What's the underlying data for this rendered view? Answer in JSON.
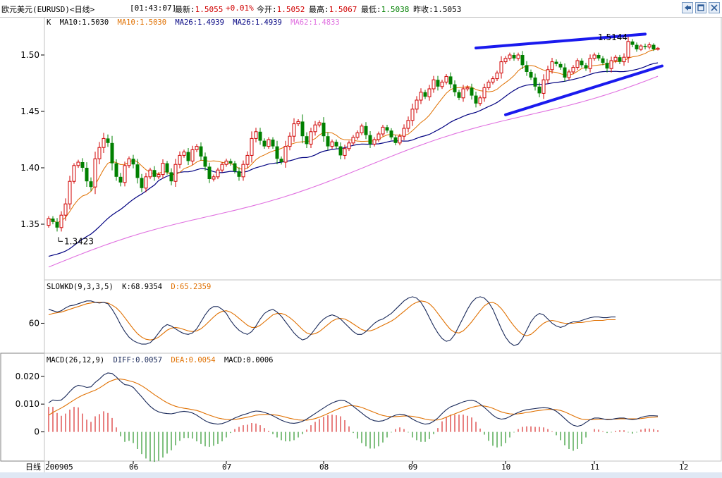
{
  "window": {
    "title": "欧元美元(EURUSD)<日线>",
    "time": "[01:43:07]",
    "quote": [
      {
        "label": "最新:",
        "value": "1.5055",
        "color": "#d00000"
      },
      {
        "label": "",
        "value": "+0.01%",
        "color": "#d00000"
      },
      {
        "label": "今开:",
        "value": "1.5052",
        "color": "#d00000"
      },
      {
        "label": "最高:",
        "value": "1.5067",
        "color": "#d00000"
      },
      {
        "label": "最低:",
        "value": "1.5038",
        "color": "#008000"
      },
      {
        "label": "昨收:",
        "value": "1.5053",
        "color": "#000000"
      }
    ],
    "buttons": [
      "back-icon",
      "restore-icon",
      "close-icon"
    ]
  },
  "chart_data": {
    "type": "candlestick",
    "x_period_label": "日线",
    "x_ticks": [
      {
        "label": "200905",
        "i": 0
      },
      {
        "label": "06",
        "i": 20
      },
      {
        "label": "07",
        "i": 42
      },
      {
        "label": "08",
        "i": 65
      },
      {
        "label": "09",
        "i": 86
      },
      {
        "label": "10",
        "i": 108
      },
      {
        "label": "11",
        "i": 129
      },
      {
        "label": "12",
        "i": 150
      }
    ],
    "price_panel": {
      "legend": [
        {
          "text": "K",
          "color": "#000000"
        },
        {
          "text": "MA10:1.5030",
          "color": "#000000"
        },
        {
          "text": "MA10:1.5030",
          "color": "#e07000"
        },
        {
          "text": "MA26:1.4939",
          "color": "#000080"
        },
        {
          "text": "MA26:1.4939",
          "color": "#000080"
        },
        {
          "text": "MA62:1.4833",
          "color": "#e070e0"
        }
      ],
      "ylim": [
        1.305,
        1.525
      ],
      "yticks": [
        "1.35",
        "1.40",
        "1.45",
        "1.50"
      ],
      "annotations": [
        {
          "text": "1.3423",
          "i": 2,
          "price": 1.3423
        },
        {
          "text": "1.5144",
          "i": 139,
          "price": 1.5144
        }
      ],
      "trendlines": [
        {
          "from": [
            101,
            1.5062
          ],
          "to": [
            141,
            1.5185
          ]
        },
        {
          "from": [
            108,
            1.447
          ],
          "to": [
            145,
            1.4903
          ]
        }
      ],
      "ma_colors": {
        "ma10": "#e07000",
        "ma26": "#000080",
        "ma62": "#e070e0"
      },
      "ma62_start": 1.312,
      "ma62_end": 1.4833,
      "ma26_start": 1.3255,
      "ma26_end": 1.4939,
      "up_color": "#d00000",
      "down_color": "#008000",
      "closes": [
        1.355,
        1.352,
        1.347,
        1.358,
        1.368,
        1.388,
        1.402,
        1.405,
        1.4,
        1.388,
        1.383,
        1.408,
        1.418,
        1.426,
        1.422,
        1.404,
        1.392,
        1.387,
        1.402,
        1.408,
        1.403,
        1.391,
        1.382,
        1.392,
        1.398,
        1.392,
        1.394,
        1.404,
        1.396,
        1.388,
        1.403,
        1.411,
        1.414,
        1.406,
        1.416,
        1.419,
        1.41,
        1.401,
        1.39,
        1.392,
        1.398,
        1.403,
        1.406,
        1.404,
        1.397,
        1.392,
        1.403,
        1.411,
        1.426,
        1.432,
        1.424,
        1.419,
        1.425,
        1.419,
        1.408,
        1.405,
        1.419,
        1.428,
        1.439,
        1.441,
        1.428,
        1.421,
        1.432,
        1.438,
        1.44,
        1.428,
        1.419,
        1.423,
        1.419,
        1.411,
        1.417,
        1.422,
        1.427,
        1.431,
        1.437,
        1.429,
        1.421,
        1.425,
        1.43,
        1.436,
        1.433,
        1.427,
        1.422,
        1.428,
        1.435,
        1.442,
        1.452,
        1.46,
        1.467,
        1.463,
        1.47,
        1.478,
        1.472,
        1.476,
        1.481,
        1.474,
        1.467,
        1.462,
        1.47,
        1.471,
        1.464,
        1.457,
        1.462,
        1.471,
        1.476,
        1.479,
        1.484,
        1.494,
        1.497,
        1.5,
        1.497,
        1.5,
        1.491,
        1.485,
        1.48,
        1.472,
        1.466,
        1.478,
        1.487,
        1.494,
        1.492,
        1.489,
        1.48,
        1.485,
        1.489,
        1.495,
        1.491,
        1.488,
        1.497,
        1.5,
        1.497,
        1.493,
        1.488,
        1.495,
        1.498,
        1.494,
        1.498,
        1.512,
        1.509,
        1.505,
        1.508,
        1.507,
        1.509,
        1.505,
        1.506
      ],
      "ranges": [
        0.006,
        0.006,
        0.01,
        0.01,
        0.014,
        0.014,
        0.006,
        0.006,
        0.01,
        0.014,
        0.01,
        0.018,
        0.014,
        0.014,
        0.01,
        0.018,
        0.01,
        0.01,
        0.01,
        0.006,
        0.01,
        0.014,
        0.01,
        0.01,
        0.006,
        0.01,
        0.006,
        0.01,
        0.006,
        0.01,
        0.014,
        0.01,
        0.006,
        0.01,
        0.01,
        0.006,
        0.01,
        0.01,
        0.01,
        0.006,
        0.006,
        0.006,
        0.006,
        0.006,
        0.006,
        0.01,
        0.01,
        0.01,
        0.018,
        0.01,
        0.01,
        0.006,
        0.006,
        0.006,
        0.014,
        0.006,
        0.014,
        0.01,
        0.014,
        0.006,
        0.018,
        0.01,
        0.01,
        0.01,
        0.006,
        0.014,
        0.01,
        0.006,
        0.006,
        0.01,
        0.01,
        0.006,
        0.006,
        0.006,
        0.006,
        0.01,
        0.01,
        0.006,
        0.006,
        0.006,
        0.006,
        0.006,
        0.006,
        0.006,
        0.01,
        0.01,
        0.014,
        0.01,
        0.01,
        0.006,
        0.01,
        0.01,
        0.01,
        0.006,
        0.006,
        0.01,
        0.01,
        0.006,
        0.01,
        0.006,
        0.01,
        0.01,
        0.006,
        0.01,
        0.006,
        0.006,
        0.006,
        0.014,
        0.006,
        0.006,
        0.006,
        0.006,
        0.01,
        0.01,
        0.006,
        0.01,
        0.01,
        0.014,
        0.01,
        0.01,
        0.006,
        0.006,
        0.01,
        0.006,
        0.006,
        0.006,
        0.006,
        0.006,
        0.01,
        0.006,
        0.006,
        0.006,
        0.01,
        0.01,
        0.006,
        0.006,
        0.01,
        0.014,
        0.006,
        0.006,
        0.004,
        0.006,
        0.006,
        0.004,
        0.003
      ]
    },
    "kd_panel": {
      "label": "SLOWKD(9,3,3,5)",
      "k_text": "K:68.9354",
      "d_text": "D:65.2359",
      "k_color": "#1a2a5a",
      "d_color": "#e07000",
      "ylim": [
        20,
        105
      ],
      "ytick": "60",
      "k": [
        80,
        78,
        76,
        78,
        82,
        85,
        86,
        88,
        90,
        92,
        92,
        90,
        89,
        90,
        88,
        80,
        70,
        58,
        48,
        40,
        35,
        32,
        30,
        30,
        32,
        38,
        46,
        54,
        58,
        56,
        52,
        48,
        45,
        44,
        46,
        52,
        62,
        72,
        80,
        84,
        84,
        80,
        74,
        64,
        56,
        50,
        46,
        44,
        48,
        56,
        66,
        74,
        78,
        80,
        76,
        70,
        62,
        54,
        46,
        40,
        36,
        38,
        44,
        52,
        60,
        66,
        70,
        72,
        70,
        66,
        60,
        54,
        48,
        44,
        44,
        48,
        54,
        60,
        64,
        66,
        70,
        74,
        80,
        86,
        92,
        96,
        98,
        96,
        90,
        80,
        68,
        56,
        46,
        38,
        34,
        36,
        44,
        56,
        68,
        80,
        90,
        96,
        98,
        96,
        90,
        80,
        66,
        52,
        40,
        32,
        28,
        30,
        38,
        50,
        62,
        70,
        74,
        72,
        66,
        60,
        56,
        54,
        56,
        60,
        62,
        62,
        64,
        66,
        68,
        69,
        69,
        68,
        68,
        69,
        69
      ],
      "d": [
        72,
        74,
        75,
        76,
        78,
        80,
        82,
        84,
        86,
        88,
        89,
        90,
        90,
        90,
        89,
        86,
        82,
        76,
        68,
        60,
        52,
        45,
        40,
        37,
        36,
        37,
        40,
        45,
        50,
        53,
        54,
        53,
        51,
        49,
        48,
        49,
        52,
        57,
        63,
        69,
        74,
        77,
        78,
        76,
        72,
        67,
        62,
        57,
        54,
        54,
        57,
        62,
        67,
        72,
        74,
        74,
        72,
        68,
        63,
        57,
        51,
        46,
        44,
        45,
        48,
        53,
        58,
        63,
        66,
        67,
        66,
        63,
        59,
        55,
        51,
        49,
        49,
        51,
        54,
        57,
        60,
        63,
        67,
        72,
        77,
        82,
        87,
        90,
        92,
        91,
        88,
        82,
        74,
        66,
        58,
        51,
        47,
        46,
        49,
        55,
        62,
        70,
        78,
        85,
        89,
        90,
        87,
        81,
        73,
        64,
        56,
        49,
        44,
        42,
        44,
        49,
        55,
        60,
        63,
        64,
        63,
        61,
        60,
        60,
        60,
        61,
        61,
        62,
        63,
        64,
        64,
        64,
        65,
        65,
        65
      ]
    },
    "macd_panel": {
      "label": "MACD(26,12,9)",
      "diff_text": "DIFF:0.0057",
      "dea_text": "DEA:0.0054",
      "macd_text": "MACD:0.0006",
      "diff_color": "#1a2a5a",
      "dea_color": "#e07000",
      "ylim": [
        -0.01,
        0.024
      ],
      "yticks": [
        "0.020",
        "0.010",
        "0"
      ],
      "diff": [
        0.0105,
        0.0115,
        0.0112,
        0.0115,
        0.0128,
        0.0145,
        0.016,
        0.0168,
        0.0165,
        0.016,
        0.0162,
        0.0178,
        0.019,
        0.0205,
        0.0212,
        0.021,
        0.0198,
        0.0182,
        0.017,
        0.0168,
        0.016,
        0.0143,
        0.0126,
        0.0108,
        0.0092,
        0.008,
        0.0072,
        0.0068,
        0.0066,
        0.0065,
        0.0068,
        0.0072,
        0.0074,
        0.0072,
        0.0068,
        0.006,
        0.005,
        0.004,
        0.0033,
        0.003,
        0.0028,
        0.003,
        0.0035,
        0.0042,
        0.005,
        0.0056,
        0.0062,
        0.0066,
        0.0072,
        0.0075,
        0.0074,
        0.007,
        0.0065,
        0.0058,
        0.005,
        0.0042,
        0.0036,
        0.0032,
        0.0031,
        0.0033,
        0.0038,
        0.0046,
        0.0056,
        0.0066,
        0.0076,
        0.0086,
        0.0096,
        0.0104,
        0.011,
        0.0114,
        0.0112,
        0.0104,
        0.0092,
        0.008,
        0.0068,
        0.0056,
        0.0046,
        0.004,
        0.0038,
        0.004,
        0.0046,
        0.0054,
        0.006,
        0.0064,
        0.0062,
        0.0056,
        0.0046,
        0.0038,
        0.0032,
        0.0028,
        0.003,
        0.0038,
        0.005,
        0.0066,
        0.008,
        0.009,
        0.0096,
        0.0102,
        0.0108,
        0.0112,
        0.0114,
        0.011,
        0.01,
        0.0088,
        0.0074,
        0.006,
        0.005,
        0.0046,
        0.0048,
        0.0055,
        0.0063,
        0.007,
        0.0076,
        0.008,
        0.0082,
        0.0084,
        0.0086,
        0.0087,
        0.0086,
        0.0082,
        0.0074,
        0.0062,
        0.0048,
        0.0034,
        0.0024,
        0.002,
        0.0024,
        0.0034,
        0.0044,
        0.005,
        0.005,
        0.0047,
        0.0044,
        0.0045,
        0.0048,
        0.005,
        0.005,
        0.0046,
        0.0044,
        0.0046,
        0.0052,
        0.0056,
        0.0058,
        0.0058,
        0.0057
      ],
      "dea": [
        0.006,
        0.007,
        0.0078,
        0.0086,
        0.0095,
        0.0105,
        0.0115,
        0.0124,
        0.0132,
        0.0138,
        0.0144,
        0.015,
        0.0158,
        0.0168,
        0.0178,
        0.0185,
        0.019,
        0.019,
        0.0188,
        0.0184,
        0.018,
        0.0174,
        0.0166,
        0.0156,
        0.0145,
        0.0134,
        0.0124,
        0.0114,
        0.0105,
        0.0098,
        0.0092,
        0.0088,
        0.0085,
        0.0083,
        0.008,
        0.0077,
        0.0072,
        0.0066,
        0.006,
        0.0055,
        0.005,
        0.0047,
        0.0045,
        0.0044,
        0.0045,
        0.0047,
        0.005,
        0.0053,
        0.0056,
        0.006,
        0.0062,
        0.0063,
        0.0063,
        0.0062,
        0.006,
        0.0057,
        0.0053,
        0.0049,
        0.0046,
        0.0043,
        0.0042,
        0.0042,
        0.0044,
        0.0048,
        0.0053,
        0.0059,
        0.0066,
        0.0073,
        0.008,
        0.0086,
        0.0091,
        0.0094,
        0.0094,
        0.0092,
        0.0088,
        0.0082,
        0.0076,
        0.007,
        0.0064,
        0.0059,
        0.0056,
        0.0055,
        0.0055,
        0.0056,
        0.0057,
        0.0057,
        0.0056,
        0.0053,
        0.005,
        0.0046,
        0.0043,
        0.0042,
        0.0043,
        0.0047,
        0.0053,
        0.0059,
        0.0065,
        0.0071,
        0.0077,
        0.0083,
        0.0088,
        0.0092,
        0.0094,
        0.0093,
        0.009,
        0.0085,
        0.0078,
        0.0072,
        0.0068,
        0.0065,
        0.0064,
        0.0065,
        0.0067,
        0.007,
        0.0072,
        0.0075,
        0.0077,
        0.0079,
        0.0081,
        0.0081,
        0.008,
        0.0077,
        0.0072,
        0.0065,
        0.0058,
        0.0051,
        0.0046,
        0.0044,
        0.0044,
        0.0045,
        0.0046,
        0.0046,
        0.0046,
        0.0046,
        0.0046,
        0.0047,
        0.0047,
        0.0047,
        0.0047,
        0.0047,
        0.0048,
        0.005,
        0.0052,
        0.0053,
        0.0054
      ]
    }
  }
}
